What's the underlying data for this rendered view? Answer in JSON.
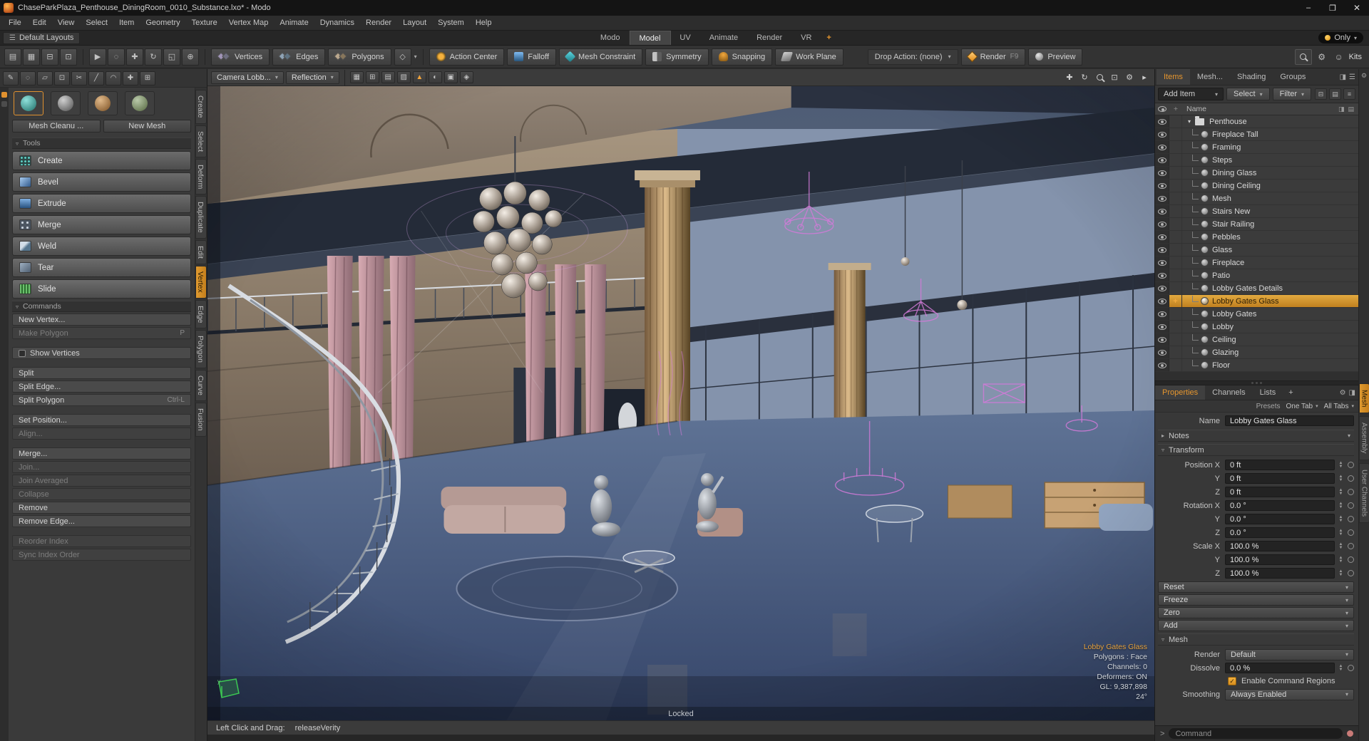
{
  "colors": {
    "accent": "#e6962e",
    "selection": "#d2912f",
    "viewport_floor": "#4a5d80",
    "wireframe_magenta": "#d27bd8"
  },
  "window": {
    "title": "ChaseParkPlaza_Penthouse_DiningRoom_0010_Substance.lxo* - Modo",
    "minimize": "–",
    "maximize": "❐",
    "close": "✕"
  },
  "menu": {
    "items": [
      "File",
      "Edit",
      "View",
      "Select",
      "Item",
      "Geometry",
      "Texture",
      "Vertex Map",
      "Animate",
      "Dynamics",
      "Render",
      "Layout",
      "System",
      "Help"
    ]
  },
  "layout_bar": {
    "hamburger": "☰",
    "layouts_label": "Default Layouts",
    "tabs": [
      "Modo",
      "Model",
      "UV",
      "Animate",
      "Render",
      "VR"
    ],
    "active_tab": "Model",
    "add_tab": "+",
    "only_label": "Only",
    "only_arrow": "▾"
  },
  "toolbar": {
    "left_icons": [
      {
        "name": "layout-single-icon",
        "glyph": "▤"
      },
      {
        "name": "layout-quad-icon",
        "glyph": "▦"
      },
      {
        "name": "layout-split-icon",
        "glyph": "⊟"
      },
      {
        "name": "layout-custom-icon",
        "glyph": "⊡"
      }
    ],
    "tool_icons": [
      {
        "name": "select-tool-icon",
        "glyph": "▶"
      },
      {
        "name": "lasso-tool-icon",
        "glyph": "◌"
      },
      {
        "name": "move-tool-icon",
        "glyph": "✚"
      },
      {
        "name": "rotate-tool-icon",
        "glyph": "↻"
      },
      {
        "name": "scale-tool-icon",
        "glyph": "◱"
      },
      {
        "name": "transform-tool-icon",
        "glyph": "⊕"
      }
    ],
    "modes": [
      {
        "label": "Vertices",
        "name": "vertices-mode-button"
      },
      {
        "label": "Edges",
        "name": "edges-mode-button"
      },
      {
        "label": "Polygons",
        "name": "polygons-mode-button"
      }
    ],
    "mode_arrow": "▾",
    "toggles": [
      {
        "label": "Action Center",
        "name": "action-center-button"
      },
      {
        "label": "Falloff",
        "name": "falloff-button"
      },
      {
        "label": "Mesh Constraint",
        "name": "mesh-constraint-button"
      },
      {
        "label": "Symmetry",
        "name": "symmetry-button"
      },
      {
        "label": "Snapping",
        "name": "snapping-button"
      },
      {
        "label": "Work Plane",
        "name": "work-plane-button"
      }
    ],
    "drop_action": "Drop Action: (none)",
    "drop_arrow": "▾",
    "render_label": "Render",
    "render_key": "F9",
    "preview_label": "Preview",
    "kit_icons": [
      {
        "name": "kits-gear-icon",
        "glyph": "⚙"
      },
      {
        "name": "kits-user-icon",
        "glyph": "☺"
      }
    ],
    "kits_label": "Kits"
  },
  "toolbar2": {
    "icons": [
      {
        "name": "pen-tool-icon",
        "glyph": "✎"
      },
      {
        "name": "airbrush-tool-icon",
        "glyph": "◌"
      },
      {
        "name": "eraser-tool-icon",
        "glyph": "▱"
      },
      {
        "name": "stamp-tool-icon",
        "glyph": "⊡"
      },
      {
        "name": "knife-tool-icon",
        "glyph": "✂"
      },
      {
        "name": "slice-tool-icon",
        "glyph": "╱"
      },
      {
        "name": "curve-tool-icon",
        "glyph": "◠"
      },
      {
        "name": "add-point-tool-icon",
        "glyph": "✚"
      },
      {
        "name": "snap-grid-tool-icon",
        "glyph": "⊞"
      }
    ]
  },
  "left_panel": {
    "palette_icons": [
      {
        "name": "primitive-sphere-tool-icon",
        "selected": true
      },
      {
        "name": "mesh-edit-tool-icon",
        "selected": false
      },
      {
        "name": "sculpt-tool-icon",
        "selected": false
      },
      {
        "name": "figure-tool-icon",
        "selected": false
      }
    ],
    "mesh_cleanup": "Mesh Cleanu ...",
    "new_mesh": "New Mesh",
    "tools_header": "Tools",
    "tools": [
      {
        "label": "Create",
        "icon": "create"
      },
      {
        "label": "Bevel",
        "icon": "bevel"
      },
      {
        "label": "Extrude",
        "icon": "extrude"
      },
      {
        "label": "Merge",
        "icon": "merge"
      },
      {
        "label": "Weld",
        "icon": "weld"
      },
      {
        "label": "Tear",
        "icon": "tear"
      },
      {
        "label": "Slide",
        "icon": "slide"
      }
    ],
    "commands_header": "Commands",
    "commands": [
      {
        "label": "New Vertex...",
        "enabled": true
      },
      {
        "label": "Make Polygon",
        "shortcut": "P",
        "enabled": false
      },
      {
        "divider": true
      },
      {
        "label": "Show Vertices",
        "checkbox": true,
        "enabled": true
      },
      {
        "divider": true
      },
      {
        "label": "Split",
        "enabled": true
      },
      {
        "label": "Split Edge...",
        "enabled": true
      },
      {
        "label": "Split Polygon",
        "shortcut": "Ctrl-L",
        "enabled": true
      },
      {
        "divider": true
      },
      {
        "label": "Set Position...",
        "enabled": true
      },
      {
        "label": "Align...",
        "enabled": false
      },
      {
        "divider": true
      },
      {
        "label": "Merge...",
        "enabled": true
      },
      {
        "label": "Join...",
        "enabled": false
      },
      {
        "label": "Join Averaged",
        "enabled": false
      },
      {
        "label": "Collapse",
        "enabled": false
      },
      {
        "label": "Remove",
        "enabled": true
      },
      {
        "label": "Remove Edge...",
        "enabled": true
      },
      {
        "divider": true
      },
      {
        "label": "Reorder Index",
        "enabled": false
      },
      {
        "label": "Sync Index Order",
        "enabled": false
      }
    ]
  },
  "vertical_tabs": {
    "items": [
      "Create",
      "Select",
      "Deform",
      "Duplicate",
      "Edit",
      "Vertex",
      "Edge",
      "Polygon",
      "Curve",
      "Fusion"
    ],
    "active": "Vertex"
  },
  "viewport": {
    "camera": "Camera Lobb...",
    "shading": "Reflection",
    "dropdown_arrow": "▾",
    "header_icons": [
      {
        "name": "grid-toggle-icon",
        "glyph": "▦"
      },
      {
        "name": "quad-view-icon",
        "glyph": "⊞"
      },
      {
        "name": "wireframe-toggle-icon",
        "glyph": "▤"
      },
      {
        "name": "texture-toggle-icon",
        "glyph": "▨"
      },
      {
        "name": "auto-visibility-icon",
        "glyph": "▲",
        "accent": true
      },
      {
        "name": "ghost-mode-icon",
        "glyph": "◐"
      },
      {
        "name": "proxy-display-icon",
        "glyph": "▣"
      },
      {
        "name": "overlay-toggle-icon",
        "glyph": "◈"
      }
    ],
    "gizmo_icons": [
      {
        "name": "pan-icon",
        "glyph": "✚"
      },
      {
        "name": "orbit-icon",
        "glyph": "↻"
      },
      {
        "name": "zoom-icon",
        "glyph": "mag"
      },
      {
        "name": "frame-selected-icon",
        "glyph": "⊡"
      },
      {
        "name": "viewport-settings-gear-icon",
        "glyph": "⚙"
      },
      {
        "name": "viewport-more-icon",
        "glyph": "▸"
      }
    ],
    "locked_label": "Locked",
    "info": {
      "selected": "Lobby Gates Glass",
      "lines": [
        "Polygons : Face",
        "Channels: 0",
        "Deformers: ON",
        "GL: 9,387,898",
        "24°"
      ]
    },
    "status_prefix": "Left Click and Drag:",
    "status_value": "releaseVerity",
    "axis_label": "y"
  },
  "right_panel": {
    "tabs": [
      "Items",
      "Mesh...",
      "Shading",
      "Groups"
    ],
    "active_tab": "Items",
    "tab_icons": [
      {
        "name": "panel-pin-icon",
        "glyph": "◨"
      },
      {
        "name": "panel-menu-icon",
        "glyph": "☰"
      }
    ],
    "add_item": "Add Item",
    "select_btn": "Select",
    "filter_btn": "Filter",
    "action_icons": [
      {
        "name": "collapse-all-icon",
        "glyph": "⊟"
      },
      {
        "name": "view-options-icon",
        "glyph": "▤"
      },
      {
        "name": "list-menu-icon",
        "glyph": "≡"
      }
    ],
    "header_eye": "👁",
    "header_pin": "✚",
    "name_header": "Name",
    "header_icons": [
      {
        "name": "column-toggle-icon",
        "glyph": "◨"
      },
      {
        "name": "tree-filter-icon",
        "glyph": "▤"
      }
    ],
    "tree": [
      {
        "label": "Penthouse",
        "type": "group"
      },
      {
        "label": "Fireplace Tall",
        "type": "mesh"
      },
      {
        "label": "Framing",
        "type": "mesh"
      },
      {
        "label": "Steps",
        "type": "mesh"
      },
      {
        "label": "Dining Glass",
        "type": "mesh"
      },
      {
        "label": "Dining Ceiling",
        "type": "mesh"
      },
      {
        "label": "Mesh",
        "type": "mesh"
      },
      {
        "label": "Stairs New",
        "type": "mesh"
      },
      {
        "label": "Stair Railing",
        "type": "mesh"
      },
      {
        "label": "Pebbles",
        "type": "mesh"
      },
      {
        "label": "Glass",
        "type": "mesh"
      },
      {
        "label": "Fireplace",
        "type": "mesh"
      },
      {
        "label": "Patio",
        "type": "mesh"
      },
      {
        "label": "Lobby Gates Details",
        "type": "mesh"
      },
      {
        "label": "Lobby Gates Glass",
        "type": "mesh",
        "selected": true
      },
      {
        "label": "Lobby Gates",
        "type": "mesh"
      },
      {
        "label": "Lobby",
        "type": "mesh"
      },
      {
        "label": "Ceiling",
        "type": "mesh"
      },
      {
        "label": "Glazing",
        "type": "mesh"
      },
      {
        "label": "Floor",
        "type": "mesh"
      }
    ],
    "properties": {
      "tabs": [
        "Properties",
        "Channels",
        "Lists"
      ],
      "active_tab": "Properties",
      "add_tab": "+",
      "tab_icons": [
        {
          "name": "form-gear-icon",
          "glyph": "⚙"
        },
        {
          "name": "form-pin-icon",
          "glyph": "◨"
        }
      ],
      "presets_label": "Presets",
      "one_tab": "One Tab",
      "all_tabs": "All Tabs",
      "name_label": "Name",
      "name_value": "Lobby Gates Glass",
      "notes_header": "Notes",
      "transform_header": "Transform",
      "transform_rows": [
        {
          "label": "Position X",
          "value": "0 ft"
        },
        {
          "label": "Y",
          "value": "0 ft"
        },
        {
          "label": "Z",
          "value": "0 ft"
        },
        {
          "label": "Rotation X",
          "value": "0.0 °"
        },
        {
          "label": "Y",
          "value": "0.0 °"
        },
        {
          "label": "Z",
          "value": "0.0 °"
        },
        {
          "label": "Scale X",
          "value": "100.0 %"
        },
        {
          "label": "Y",
          "value": "100.0 %"
        },
        {
          "label": "Z",
          "value": "100.0 %"
        }
      ],
      "action_buttons": [
        "Reset",
        "Freeze",
        "Zero",
        "Add"
      ],
      "mesh_header": "Mesh",
      "render_label": "Render",
      "render_value": "Default",
      "dissolve_label": "Dissolve",
      "dissolve_value": "0.0 %",
      "regions_label": "Enable Command Regions",
      "regions_check": "✓",
      "smoothing_label": "Smoothing",
      "smoothing_value": "Always Enabled"
    },
    "side_tabs": [
      {
        "label": "Mesh",
        "active": true
      },
      {
        "label": "Assembly",
        "active": false
      },
      {
        "label": "User Channels",
        "active": false
      }
    ],
    "strip_icon": "⚙",
    "command_prompt": ">",
    "command_placeholder": "Command"
  }
}
